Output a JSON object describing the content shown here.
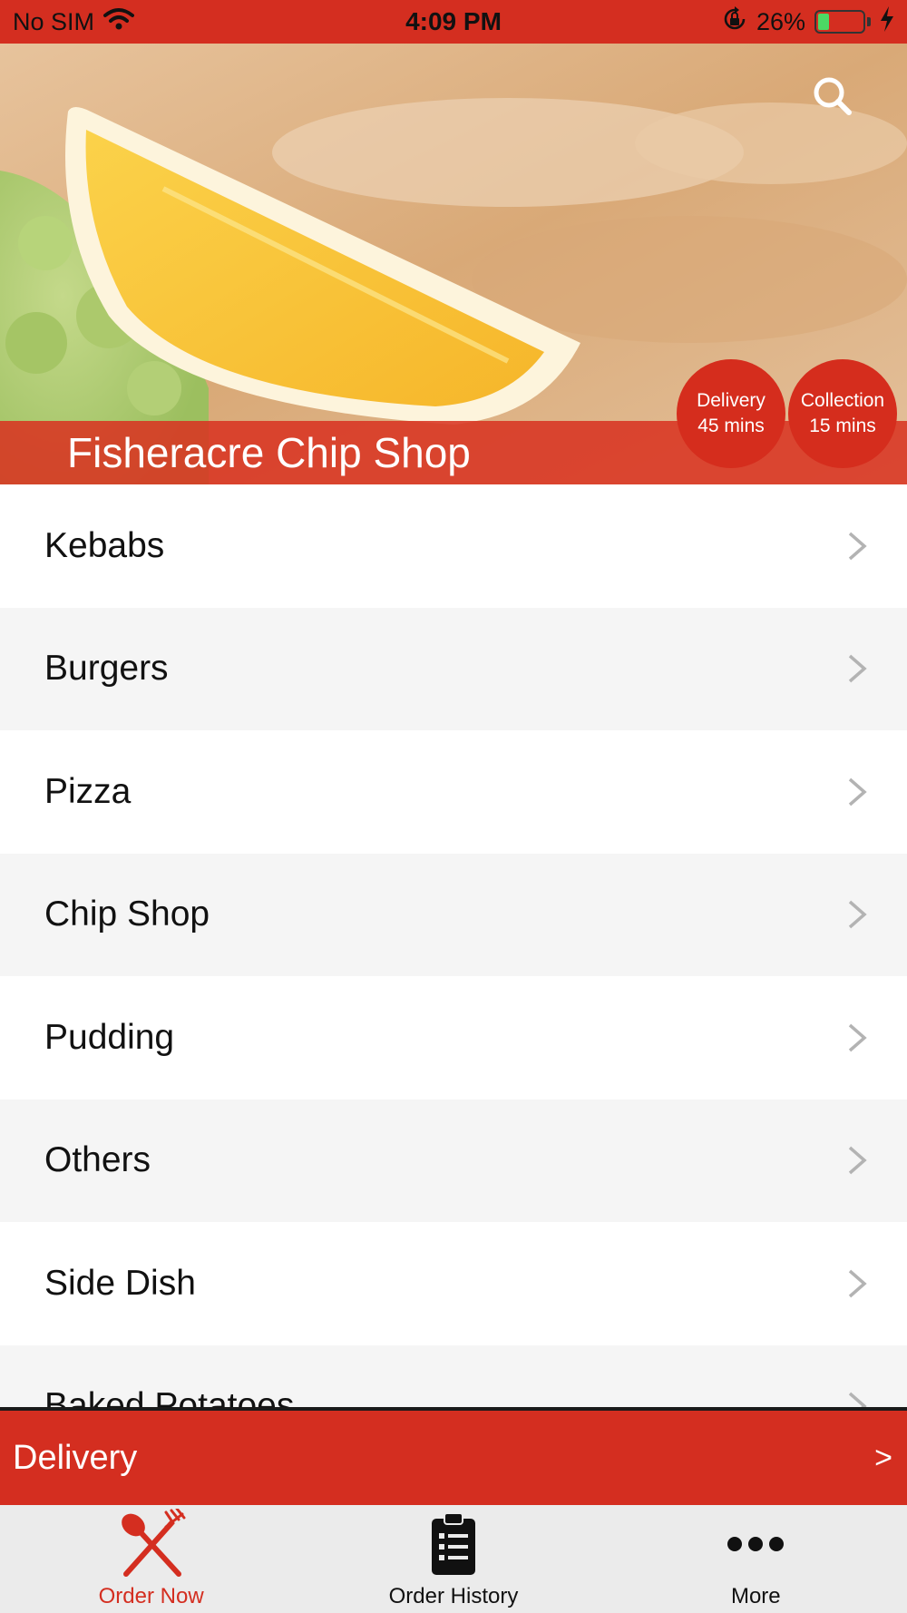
{
  "status_bar": {
    "carrier": "No SIM",
    "time": "4:09 PM",
    "battery_percent": "26%",
    "battery_level": 0.26,
    "icons": [
      "wifi-icon",
      "rotation-lock-icon",
      "battery-icon",
      "charging-icon"
    ]
  },
  "hero": {
    "shop_name": "Fisheracre Chip Shop",
    "delivery_badge": {
      "label": "Delivery",
      "time": "45 mins"
    },
    "collection_badge": {
      "label": "Collection",
      "time": "15 mins"
    },
    "search_icon": "search-icon"
  },
  "menu": {
    "items": [
      {
        "label": "Kebabs"
      },
      {
        "label": "Burgers"
      },
      {
        "label": "Pizza"
      },
      {
        "label": "Chip Shop"
      },
      {
        "label": "Pudding"
      },
      {
        "label": "Others"
      },
      {
        "label": "Side Dish"
      },
      {
        "label": "Baked Potatoes"
      }
    ]
  },
  "delivery_bar": {
    "label": "Delivery",
    "arrow": ">"
  },
  "tabs": [
    {
      "label": "Order Now",
      "icon": "fork-knife-icon",
      "active": true
    },
    {
      "label": "Order History",
      "icon": "clipboard-list-icon",
      "active": false
    },
    {
      "label": "More",
      "icon": "more-dots-icon",
      "active": false
    }
  ],
  "colors": {
    "accent": "#d42e20",
    "tab_bar_bg": "#ebebeb",
    "row_alt_bg": "#f5f5f5"
  }
}
